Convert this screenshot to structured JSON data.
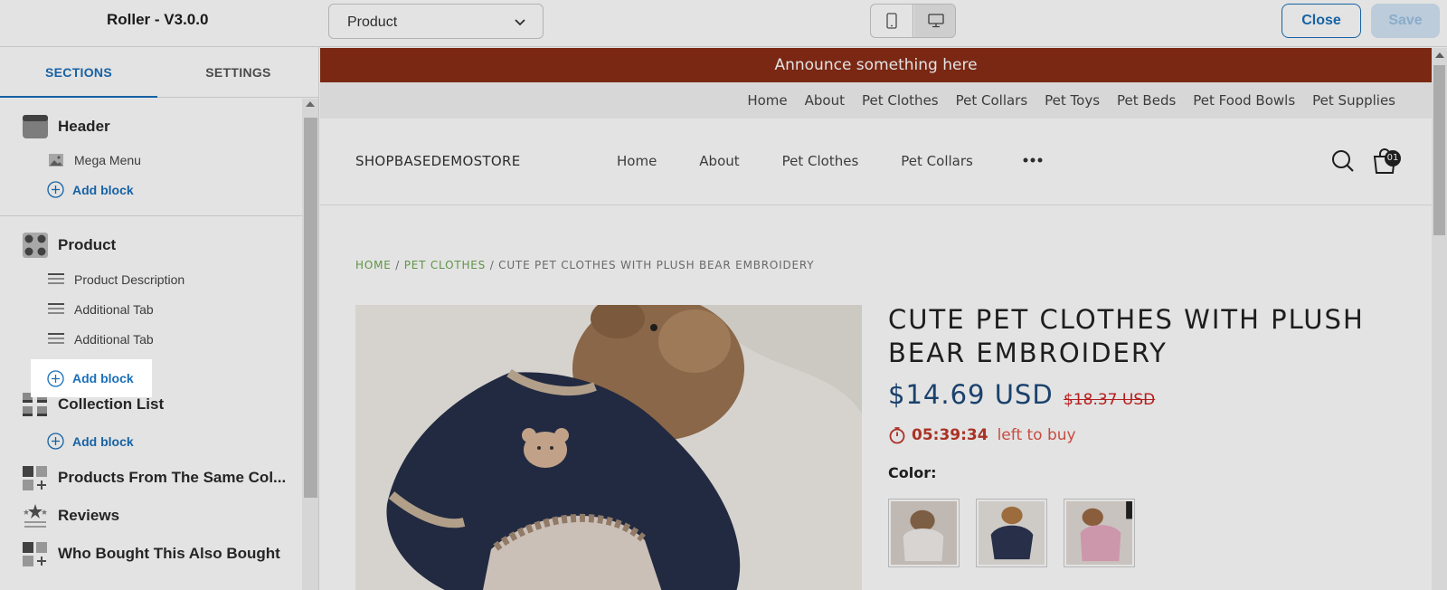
{
  "app": {
    "title": "Roller - V3.0.0"
  },
  "page_selector": {
    "value": "Product"
  },
  "actions": {
    "close": "Close",
    "save": "Save"
  },
  "panel": {
    "tabs": [
      {
        "label": "SECTIONS"
      },
      {
        "label": "SETTINGS"
      }
    ],
    "sections": {
      "header": {
        "label": "Header",
        "blocks": [
          "Mega Menu"
        ]
      },
      "product": {
        "label": "Product",
        "blocks": [
          "Product Description",
          "Additional Tab",
          "Additional Tab"
        ]
      },
      "collection_list": {
        "label": "Collection List"
      },
      "products_same": {
        "label": "Products From The Same Col..."
      },
      "reviews": {
        "label": "Reviews"
      },
      "who_bought": {
        "label": "Who Bought This Also Bought"
      }
    },
    "add_block": "Add block"
  },
  "preview": {
    "announcement": "Announce something here",
    "top_nav": [
      "Home",
      "About",
      "Pet Clothes",
      "Pet Collars",
      "Pet Toys",
      "Pet Beds",
      "Pet Food Bowls",
      "Pet Supplies"
    ],
    "store_name": "SHOPBASEDEMOSTORE",
    "main_nav": [
      "Home",
      "About",
      "Pet Clothes",
      "Pet Collars"
    ],
    "cart_count": "01",
    "breadcrumb": {
      "home": "HOME",
      "sep": " / ",
      "category": "PET CLOTHES",
      "current": "CUTE PET CLOTHES WITH PLUSH BEAR EMBROIDERY"
    },
    "product": {
      "title": "CUTE PET CLOTHES WITH PLUSH BEAR EMBROIDERY",
      "price": "$14.69 USD",
      "compare_price": "$18.37 USD",
      "timer": "05:39:34",
      "timer_suffix": "left to buy",
      "color_label": "Color:"
    }
  },
  "colors": {
    "accent": "#1a6fb9",
    "announce_bg": "#8a2d17",
    "price": "#1e4a7a",
    "sale": "#c22"
  }
}
